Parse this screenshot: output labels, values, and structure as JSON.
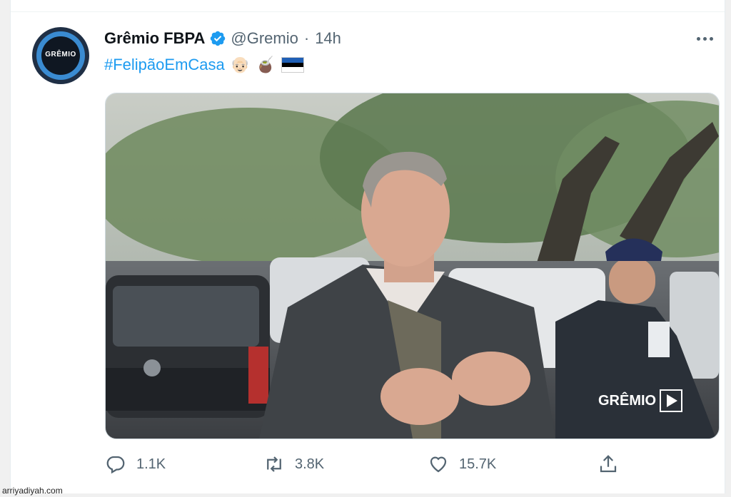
{
  "tweet": {
    "display_name": "Grêmio FBPA",
    "handle": "@Gremio",
    "separator": "·",
    "time": "14h",
    "hashtag": "#FelipãoEmCasa",
    "emojis": [
      "👴🏻",
      "🧉"
    ],
    "avatar_text": "GRÊMIO"
  },
  "media": {
    "overlay_logo_text": "GRÊMIO"
  },
  "actions": {
    "reply_count": "1.1K",
    "retweet_count": "3.8K",
    "like_count": "15.7K"
  },
  "watermark": "arriyadiyah.com",
  "colors": {
    "link": "#1d9bf0",
    "secondary": "#536471",
    "verified": "#1d9bf0"
  },
  "icons": [
    "verified-icon",
    "more-icon",
    "reply-icon",
    "retweet-icon",
    "like-icon",
    "share-icon",
    "estonia-flag-icon",
    "play-icon"
  ]
}
